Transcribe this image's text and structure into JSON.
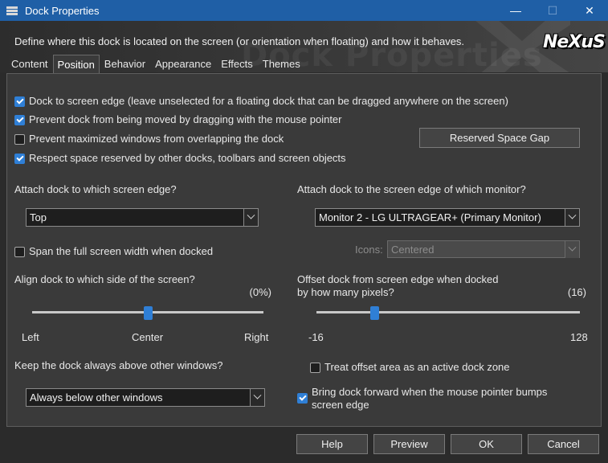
{
  "window": {
    "title": "Dock Properties",
    "controls": {
      "minimize": "—",
      "maximize": "☐",
      "close": "✕"
    }
  },
  "header": {
    "description": "Define where this dock is located on the screen (or orientation when floating) and how it behaves.",
    "watermark": "Dock Properties",
    "logo": "NeXuS"
  },
  "tabs": [
    {
      "label": "Content",
      "active": false
    },
    {
      "label": "Position",
      "active": true
    },
    {
      "label": "Behavior",
      "active": false
    },
    {
      "label": "Appearance",
      "active": false
    },
    {
      "label": "Effects",
      "active": false
    },
    {
      "label": "Themes",
      "active": false
    }
  ],
  "options": {
    "dock_to_edge": {
      "label": "Dock to screen edge (leave unselected for a floating dock that can be dragged anywhere on the screen)",
      "checked": true
    },
    "prevent_drag": {
      "label": "Prevent dock from being moved by dragging with the mouse pointer",
      "checked": true
    },
    "prevent_overlap": {
      "label": "Prevent maximized windows from overlapping the dock",
      "checked": false
    },
    "respect_space": {
      "label": "Respect space reserved by other docks, toolbars and screen objects",
      "checked": true
    }
  },
  "reserved_space_button": "Reserved Space Gap",
  "edge": {
    "label": "Attach dock to which screen edge?",
    "value": "Top"
  },
  "monitor": {
    "label": "Attach dock to the screen edge of which monitor?",
    "value": "Monitor 2 - LG ULTRAGEAR+ (Primary Monitor)"
  },
  "span_width": {
    "label": "Span the full screen width when docked",
    "checked": false
  },
  "icons": {
    "label": "Icons:",
    "value": "Centered",
    "disabled": true
  },
  "align": {
    "label": "Align dock to which side of the screen?",
    "value_text": "(0%)",
    "fraction": 0.5,
    "tick_left": "Left",
    "tick_center": "Center",
    "tick_right": "Right"
  },
  "offset": {
    "label_line1": "Offset dock from screen edge when docked",
    "label_line2": "by how many pixels?",
    "value_text": "(16)",
    "value": 16,
    "min": -16,
    "max": 128,
    "tick_min": "-16",
    "tick_max": "128"
  },
  "above": {
    "label": "Keep the dock always above other windows?",
    "value": "Always below other windows"
  },
  "offset_zone": {
    "label": "Treat offset area as an active dock zone",
    "checked": false
  },
  "bring_forward": {
    "label_line1": "Bring dock forward when the mouse pointer bumps",
    "label_line2": "screen edge",
    "checked": true
  },
  "footer": {
    "help": "Help",
    "preview": "Preview",
    "ok": "OK",
    "cancel": "Cancel"
  },
  "colors": {
    "accent": "#2f7fd6",
    "titlebar": "#1f5fa6",
    "panel": "#3a3a3a"
  }
}
